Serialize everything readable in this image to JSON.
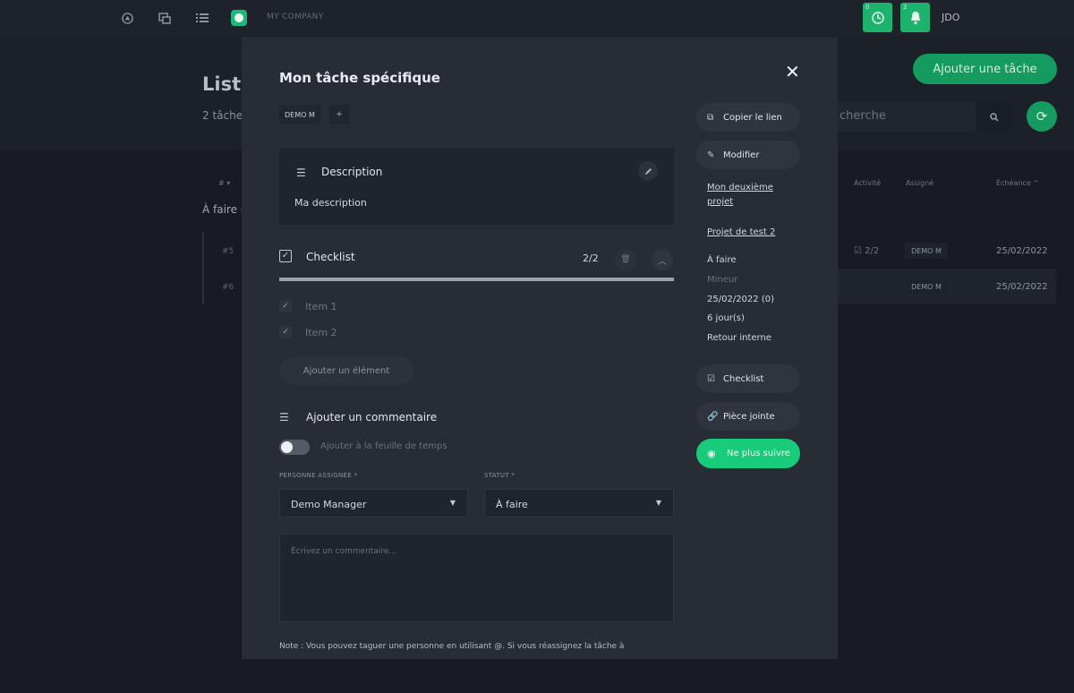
{
  "topbar": {
    "icons": [
      "home-icon",
      "copy-icon",
      "list-icon"
    ],
    "company": "MY COMPANY",
    "timer_count": "0",
    "notif_count": "2",
    "user": "JDO"
  },
  "background": {
    "title": "Liste",
    "subtitle": "2 tâche",
    "add_task_label": "Ajouter une tâche",
    "search_placeholder": "cherche",
    "columns": {
      "number": "# ▾",
      "activity": "Activité",
      "assignee": "Assigné",
      "due": "Échéance ^"
    },
    "group_label": "À faire (",
    "rows": [
      {
        "num": "#5",
        "activity": "2/2",
        "assignee": "DEMO M",
        "date": "25/02/2022"
      },
      {
        "num": "#6",
        "activity": "",
        "assignee": "DEMO M",
        "date": "25/02/2022"
      }
    ]
  },
  "modal": {
    "title": "Mon tâche spécifique",
    "tag": "DEMO M",
    "tag_add": "+",
    "description": {
      "title": "Description",
      "text": "Ma description"
    },
    "checklist": {
      "title": "Checklist",
      "count": "2/2",
      "progress": 1.0,
      "items": [
        {
          "label": "Item 1",
          "checked": true
        },
        {
          "label": "Item 2",
          "checked": true
        }
      ],
      "add_label": "Ajouter un élément"
    },
    "comment": {
      "title": "Ajouter un commentaire",
      "toggle_label": "Ajouter à la feuille de temps",
      "assignee_label": "PERSONNE ASSIGNÉE *",
      "assignee_value": "Demo Manager",
      "status_label": "STATUT *",
      "status_value": "À faire",
      "placeholder": "Écrivez un commentaire...",
      "note": "Note : Vous pouvez taguer une personne en utilisant @. Si vous réassignez la tâche à"
    },
    "side": {
      "copy_link": "Copier le lien",
      "edit": "Modifier",
      "project_line1": "Mon deuxième",
      "project_line2": "projet",
      "project2": "Projet de test 2",
      "status": "À faire",
      "priority": "Mineur",
      "due_date": "25/02/2022 (0)",
      "duration": "6 jour(s)",
      "type": "Retour interne",
      "checklist_btn": "Checklist",
      "attachment_btn": "Pièce jointe",
      "unfollow_btn": "Ne plus suivre"
    }
  },
  "colors": {
    "accent": "#19cc7b",
    "modal_bg": "#282c35",
    "page_bg": "#181b22"
  }
}
